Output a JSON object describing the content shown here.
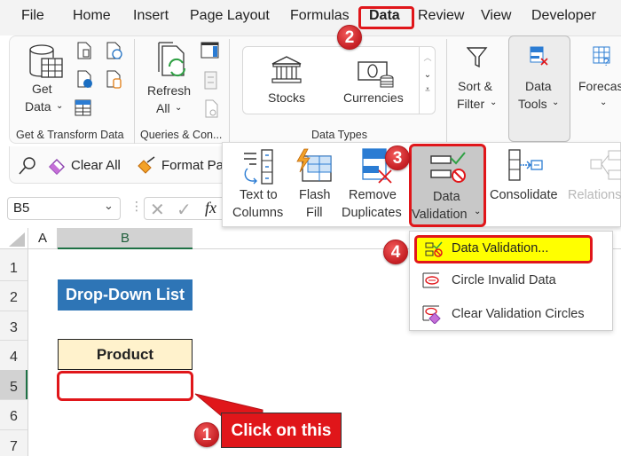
{
  "tabs": [
    {
      "label": "File"
    },
    {
      "label": "Home"
    },
    {
      "label": "Insert"
    },
    {
      "label": "Page Layout"
    },
    {
      "label": "Formulas"
    },
    {
      "label": "Data",
      "active": true
    },
    {
      "label": "Review"
    },
    {
      "label": "View"
    },
    {
      "label": "Developer"
    }
  ],
  "ribbon": {
    "get_transform": {
      "get_data_line1": "Get",
      "get_data_line2": "Data",
      "group_label": "Get & Transform Data"
    },
    "queries": {
      "refresh_line1": "Refresh",
      "refresh_line2": "All",
      "group_label": "Queries & Con..."
    },
    "data_types": {
      "stocks": "Stocks",
      "currencies": "Currencies",
      "group_label": "Data Types"
    },
    "sort_filter": {
      "line1": "Sort &",
      "line2": "Filter"
    },
    "data_tools": {
      "line1": "Data",
      "line2": "Tools"
    },
    "forecast": {
      "line1": "Forecas"
    }
  },
  "toolbar2": {
    "clear_all": "Clear All",
    "format_painter": "Format Pa"
  },
  "formula_bar": {
    "name_box": "B5",
    "fx": "fx"
  },
  "grid": {
    "columns": [
      "A",
      "B"
    ],
    "rows": [
      "1",
      "2",
      "3",
      "4",
      "5",
      "6",
      "7"
    ],
    "cells": {
      "B2": "Drop-Down List",
      "B4": "Product",
      "B5": ""
    }
  },
  "data_tools_panel": {
    "text_to_columns_1": "Text to",
    "text_to_columns_2": "Columns",
    "flash_fill_1": "Flash",
    "flash_fill_2": "Fill",
    "remove_dup_1": "Remove",
    "remove_dup_2": "Duplicates",
    "data_validation_1": "Data",
    "data_validation_2": "Validation",
    "consolidate": "Consolidate",
    "relationships": "Relations"
  },
  "validation_menu": [
    {
      "label": "Data Validation...",
      "accel": "V"
    },
    {
      "label": "Circle Invalid Data",
      "accel": "i"
    },
    {
      "label": "Clear Validation Circles",
      "accel": "r"
    }
  ],
  "annotations": {
    "step1": "1",
    "step2": "2",
    "step3": "3",
    "step4": "4",
    "callout": "Click on this"
  },
  "colors": {
    "accent_red": "#e0161a",
    "highlight_yellow": "#ffff00",
    "header_blue": "#2e75b6",
    "product_fill": "#fff2cc"
  }
}
